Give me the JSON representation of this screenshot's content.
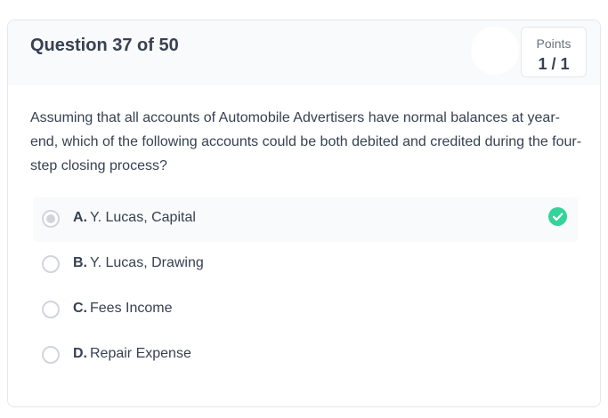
{
  "question": {
    "title": "Question 37 of 50",
    "points_label": "Points",
    "points_value": "1 / 1",
    "text": "Assuming that all accounts of Automobile Advertisers have normal balances at year-end, which of the following accounts could be both debited and credited during the four-step closing process?"
  },
  "options": [
    {
      "letter": "A.",
      "text": "Y. Lucas, Capital",
      "selected": true,
      "correct": true
    },
    {
      "letter": "B.",
      "text": "Y. Lucas, Drawing",
      "selected": false,
      "correct": false
    },
    {
      "letter": "C.",
      "text": "Fees Income",
      "selected": false,
      "correct": false
    },
    {
      "letter": "D.",
      "text": "Repair Expense",
      "selected": false,
      "correct": false
    }
  ],
  "colors": {
    "correct_check": "#34d399",
    "selected_bg": "#f9fafb",
    "header_bg": "#f9fafb"
  },
  "icons": {
    "correct": "check-circle-icon"
  }
}
